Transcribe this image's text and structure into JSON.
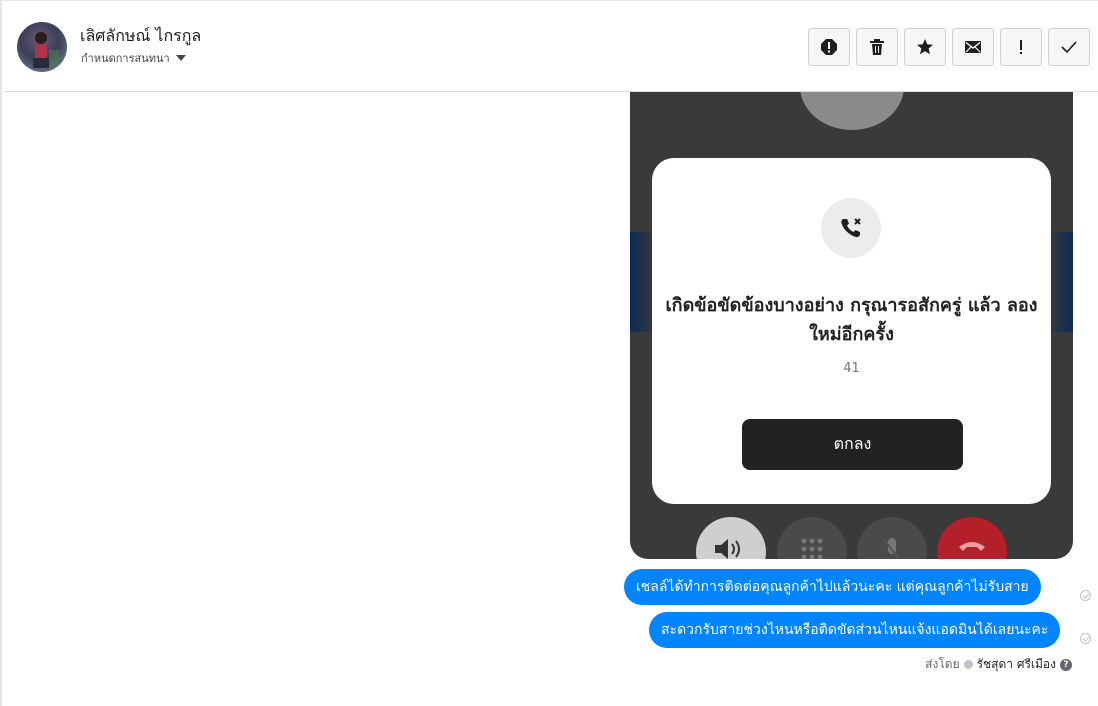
{
  "header": {
    "contact_name": "เลิศลักษณ์ ไกรกูล",
    "assign_label": "กำหนดการสนทนา"
  },
  "toolbar": {
    "buttons": [
      "spam-alert-icon",
      "trash-icon",
      "star-icon",
      "envelope-icon",
      "exclamation-icon",
      "checkmark-icon"
    ]
  },
  "attachment": {
    "dialog_message": "เกิดข้อขัดข้องบางอย่าง กรุณารอสักครู่ แล้ว ลองใหม่อีกครั้ง",
    "error_code": "41",
    "ok_label": "ตกลง"
  },
  "messages": [
    {
      "text": "เชลล์ได้ทำการติดต่อคุณลูกค้าไปแล้วนะคะ  แต่คุณลูกค้าไม่รับสาย"
    },
    {
      "text": "สะดวกรับสายช่วงไหนหรือติดขัดส่วนไหนแจ้งแอดมินได้เลยนะคะ"
    }
  ],
  "footer": {
    "sent_by_label": "ส่งโดย",
    "agent_name": "รัชสุดา ศรีเมือง"
  },
  "colors": {
    "bubble": "#0084ff",
    "dark": "#3a3a3a"
  }
}
